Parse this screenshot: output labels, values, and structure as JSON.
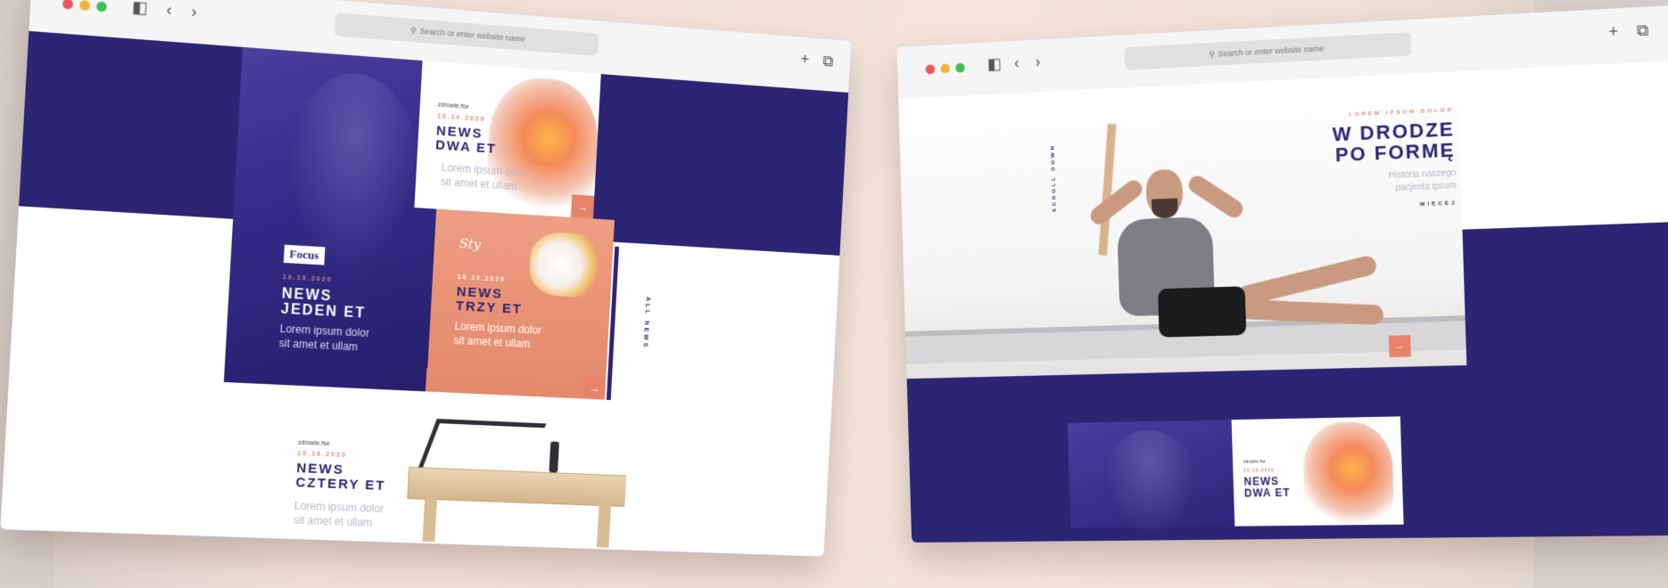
{
  "browser": {
    "address_placeholder": "Search or enter website name",
    "new_tab_symbol": "+",
    "tabs_symbol": "⧉",
    "back_symbol": "‹",
    "forward_symbol": "›",
    "sidebar_symbol": "◧",
    "search_symbol": "⚲"
  },
  "left_page": {
    "news_1": {
      "logo": "Focus",
      "date": "10.10.2020",
      "title_line1": "NEWS",
      "title_line2": "JEDEN ET",
      "desc_line1": "Lorem ipsum dolor",
      "desc_line2": "sit amet et ullam",
      "arrow": "→"
    },
    "news_2": {
      "source": "zdrowie.fse",
      "date": "10.10.2020",
      "title_line1": "NEWS",
      "title_line2": "DWA ET",
      "desc_line1": "Lorem ipsum dolor",
      "desc_line2": "sit amet et ullam",
      "arrow": "→"
    },
    "news_3": {
      "brand": "Sty",
      "date": "10.10.2020",
      "title_line1": "NEWS",
      "title_line2": "TRZY ET",
      "desc_line1": "Lorem ipsum dolor",
      "desc_line2": "sit amet et ullam",
      "arrow": "→"
    },
    "news_4": {
      "source": "zdrowie.fse",
      "date": "10.10.2020",
      "title_line1": "NEWS",
      "title_line2": "CZTERY ET",
      "desc_line1": "Lorem ipsum dolor",
      "desc_line2": "sit amet et ullam"
    },
    "side_label": "ALL NEWS"
  },
  "right_page": {
    "hero": {
      "kicker": "LOREM IPSUM DOLOR",
      "title_line1": "W DRODZE",
      "title_line2": "PO FORMĘ",
      "sub_line1": "Historia naszego",
      "sub_line2": "pacjenta ipsum",
      "more": "WIĘCEJ",
      "arrow": "→"
    },
    "side_label": "SCROLL DOWN",
    "news_2": {
      "source": "zdrowie.fse",
      "date": "10.10.2020",
      "title_line1": "NEWS",
      "title_line2": "DWA ET"
    }
  },
  "colors": {
    "navy": "#2b2574",
    "accent": "#e7836b",
    "background": "#f4e4db"
  }
}
